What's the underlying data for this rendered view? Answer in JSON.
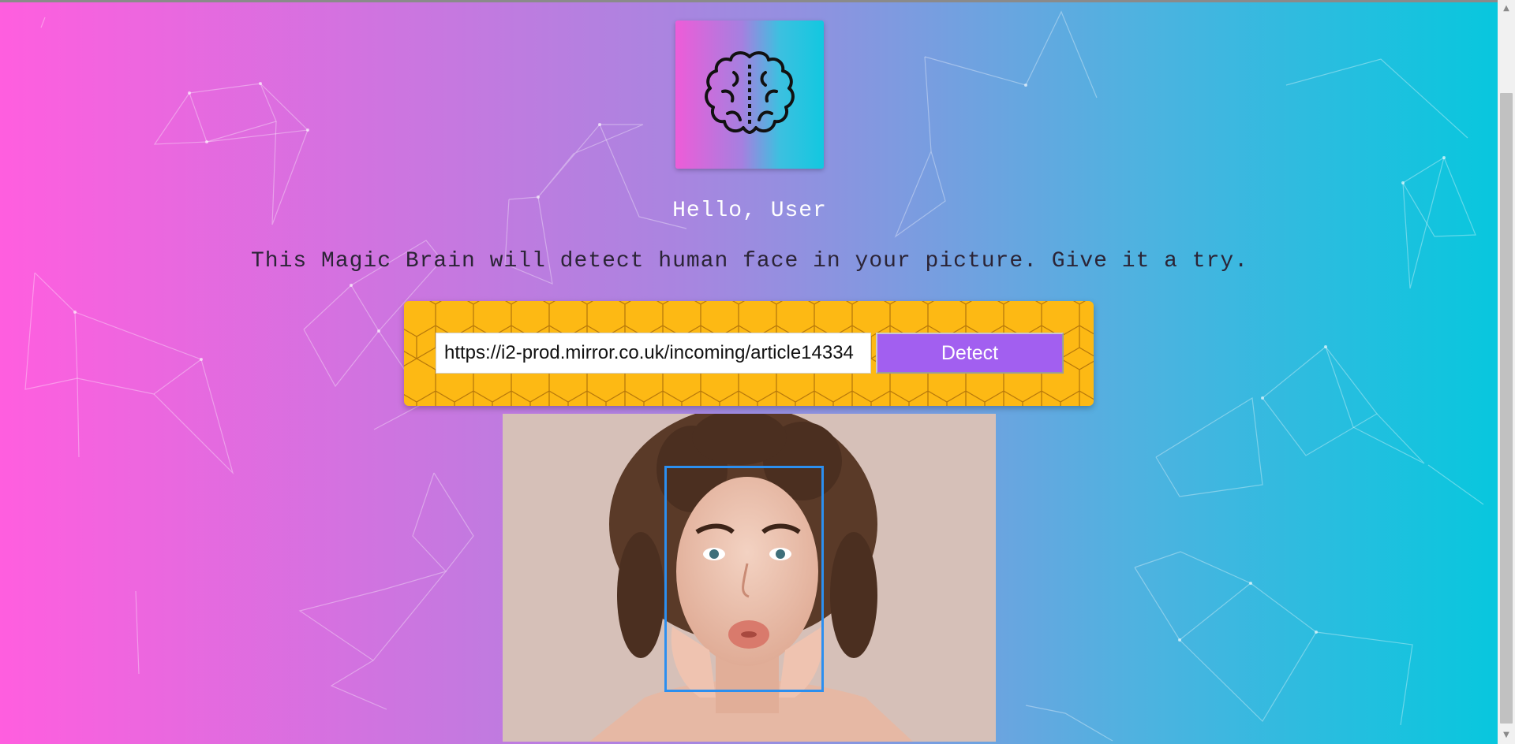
{
  "page": {
    "greeting": "Hello, User",
    "tagline": "This Magic Brain will detect human face in your picture. Give it a try."
  },
  "logo": {
    "icon": "brain-icon"
  },
  "form": {
    "url_value": "https://i2-prod.mirror.co.uk/incoming/article14334",
    "detect_label": "Detect"
  },
  "result": {
    "image_subject": "woman-face-photo",
    "face_box_color": "#2b8ff0"
  },
  "colors": {
    "gradient_left": "#ff5edf",
    "gradient_right": "#04c8de",
    "panel": "#fdb914",
    "button": "#a25ff0"
  }
}
